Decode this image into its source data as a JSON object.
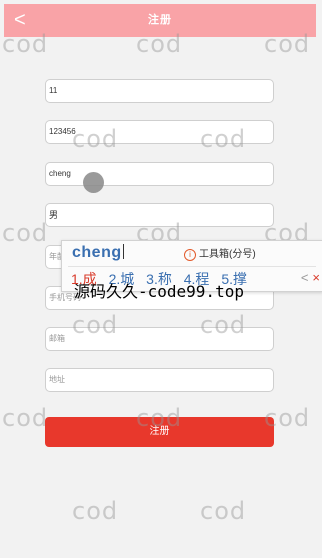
{
  "header": {
    "back_icon": "chevron-left-icon",
    "back_glyph": "<",
    "title": "注册",
    "background": "#f9a3a7"
  },
  "form": {
    "fields": [
      {
        "value": "11",
        "placeholder": ""
      },
      {
        "value": "123456",
        "placeholder": ""
      },
      {
        "value": "cheng",
        "placeholder": ""
      },
      {
        "value": "男",
        "placeholder": ""
      },
      {
        "value": "",
        "placeholder": "年龄"
      },
      {
        "value": "",
        "placeholder": "手机号码"
      },
      {
        "value": "",
        "placeholder": "邮箱"
      },
      {
        "value": "",
        "placeholder": "地址"
      }
    ],
    "submit_label": "注册",
    "submit_color": "#e8382c"
  },
  "ime": {
    "composition": "cheng",
    "toolbox_icon": "info-icon",
    "toolbox_label": "工具箱(分号)",
    "candidates": [
      "1.成",
      "2.城",
      "3.称",
      "4.程",
      "5.撑"
    ],
    "prev_glyph": "<",
    "next_glyph": "×"
  },
  "watermark": {
    "small_text": "cod",
    "big_text": "源码久久-code99.top"
  }
}
